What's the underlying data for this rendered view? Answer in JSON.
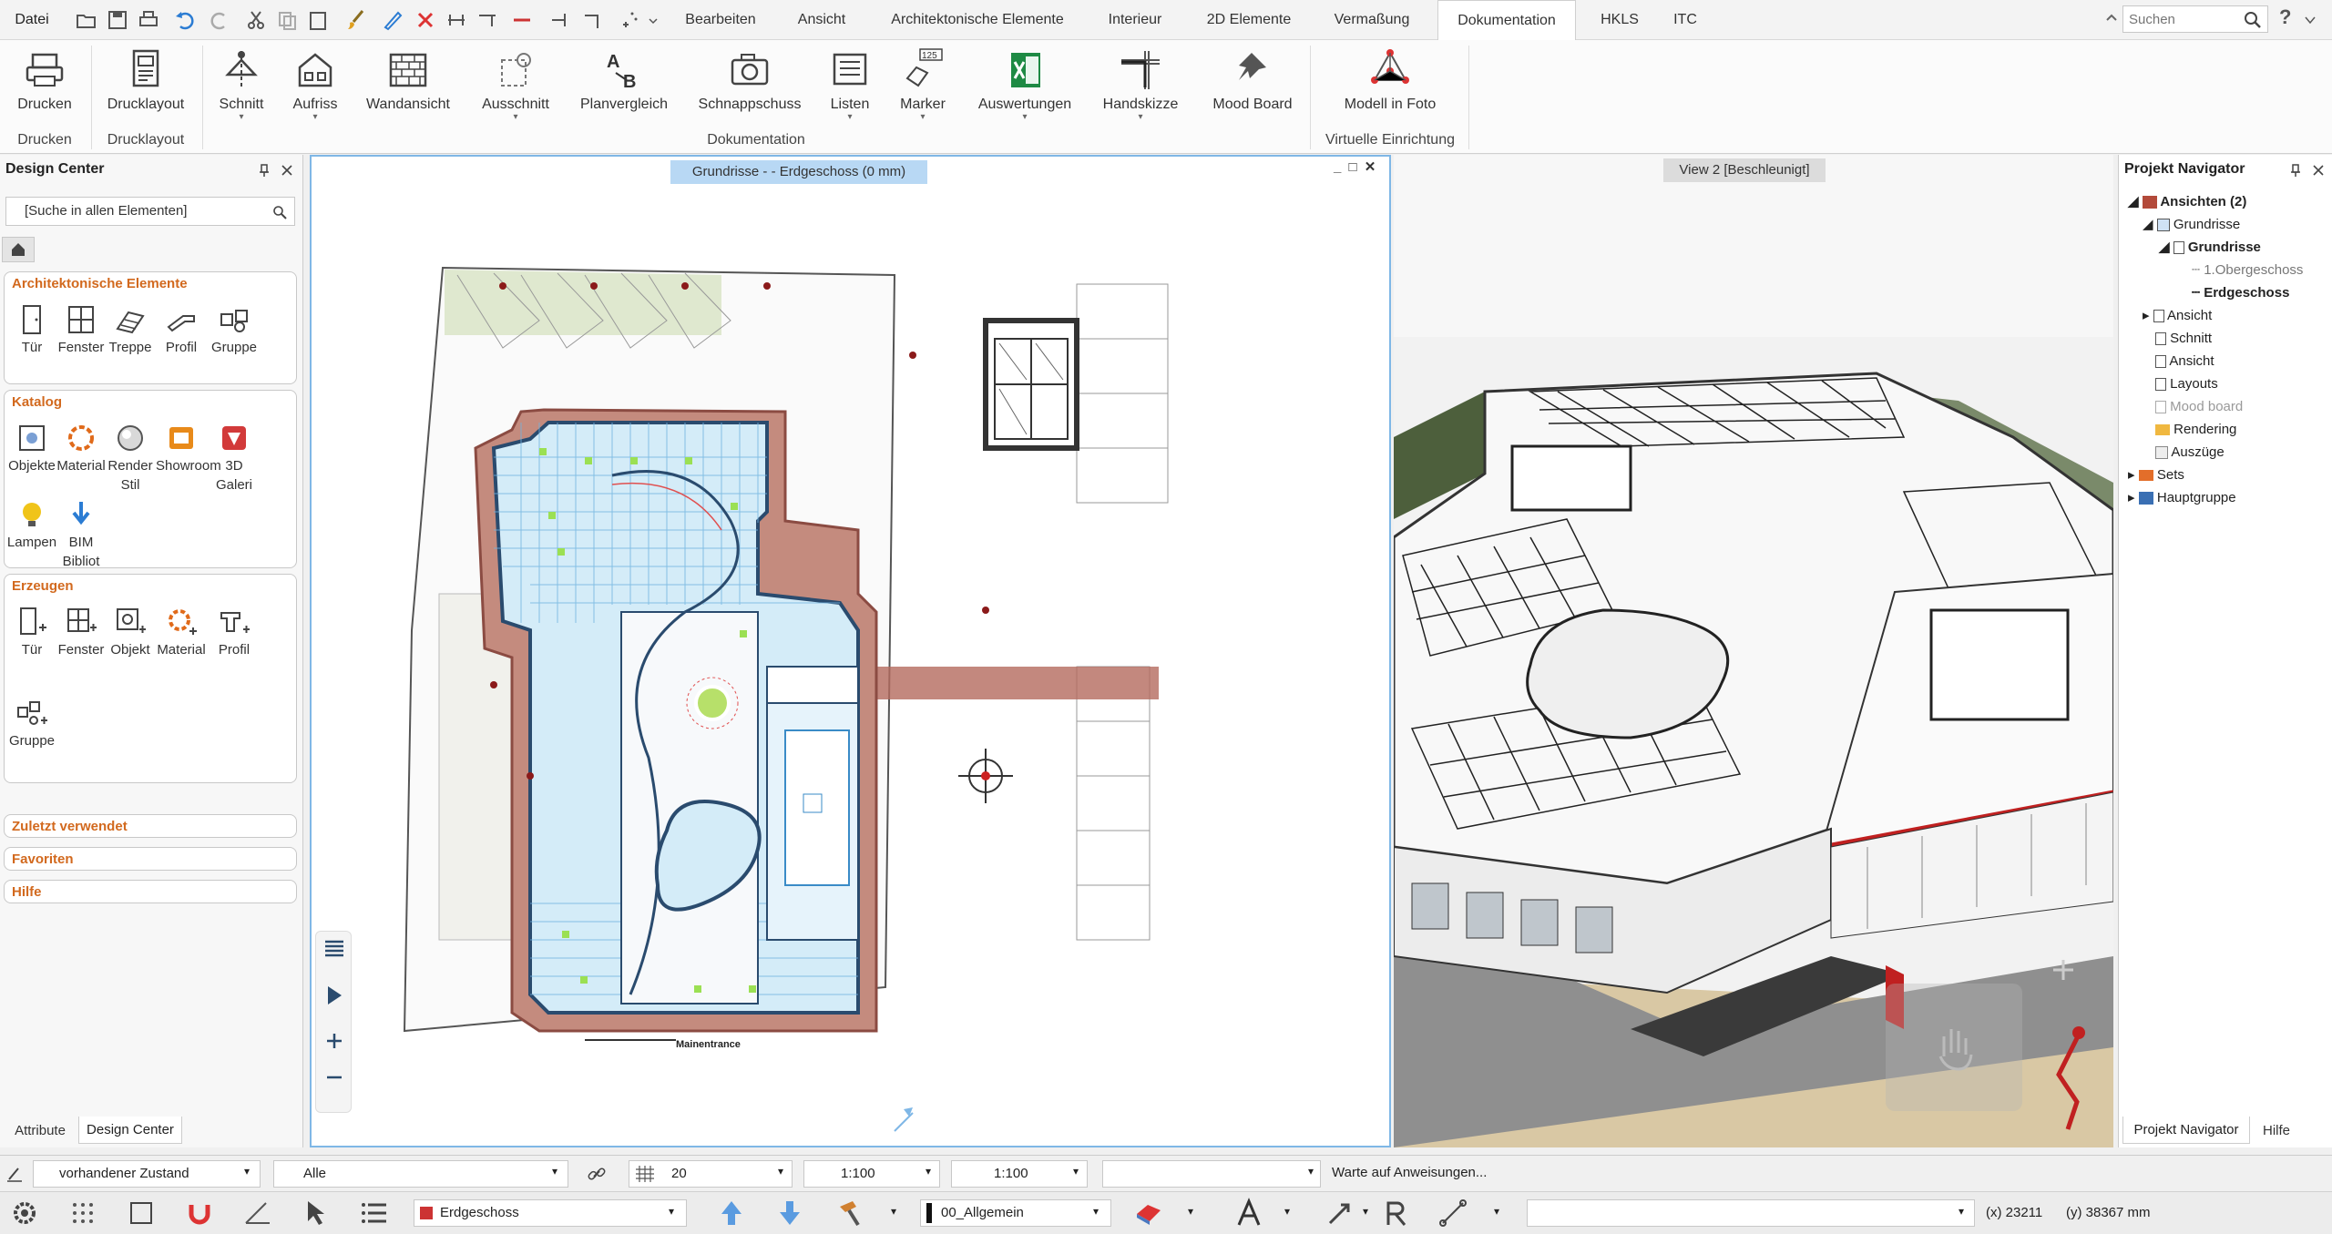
{
  "topbar": {
    "file_label": "Datei",
    "tabs": [
      "Bearbeiten",
      "Ansicht",
      "Architektonische Elemente",
      "Interieur",
      "2D Elemente",
      "Vermaßung",
      "Dokumentation",
      "HKLS",
      "ITC"
    ],
    "active_tab": "Dokumentation",
    "search_placeholder": "Suchen"
  },
  "ribbon": {
    "buttons": [
      "Drucken",
      "Drucklayout",
      "Schnitt",
      "Aufriss",
      "Wandansicht",
      "Ausschnitt",
      "Planvergleich",
      "Schnappschuss",
      "Listen",
      "Marker",
      "Auswertungen",
      "Handskizze",
      "Mood Board",
      "Modell in Foto"
    ],
    "groups": [
      "Drucken",
      "Drucklayout",
      "Dokumentation",
      "Virtuelle Einrichtung"
    ],
    "marker_badge": "125"
  },
  "design_center": {
    "title": "Design Center",
    "search_placeholder": "[Suche in allen Elementen]",
    "sections": {
      "arch": {
        "title": "Architektonische Elemente",
        "items": [
          "Tür",
          "Fenster",
          "Treppe",
          "Profil",
          "Gruppe"
        ]
      },
      "katalog": {
        "title": "Katalog",
        "items": [
          "Objekte",
          "Material",
          "Render Stil",
          "Showroom",
          "3D Galeri",
          "Lampen",
          "BIM Bibliot"
        ]
      },
      "erzeugen": {
        "title": "Erzeugen",
        "items": [
          "Tür",
          "Fenster",
          "Objekt",
          "Material",
          "Profil",
          "Gruppe"
        ]
      },
      "zuletzt": "Zuletzt verwendet",
      "favoriten": "Favoriten",
      "hilfe": "Hilfe"
    },
    "bottom_tabs": [
      "Attribute",
      "Design Center"
    ]
  },
  "viewport_plan": {
    "title": "Grundrisse -  - Erdgeschoss (0 mm)",
    "entrance_label": "Mainentrance"
  },
  "viewport_3d": {
    "title": "View 2 [Beschleunigt]"
  },
  "navigator": {
    "title": "Projekt Navigator",
    "items": [
      "Ansichten (2)",
      "Grundrisse",
      "Grundrisse",
      "1.Obergeschoss",
      "Erdgeschoss",
      "Ansicht",
      "Schnitt",
      "Ansicht",
      "Layouts",
      "Mood board",
      "Rendering",
      "Auszüge",
      "Sets",
      "Hauptgruppe"
    ],
    "bottom_tabs": [
      "Projekt Navigator",
      "Hilfe"
    ]
  },
  "statusbar": {
    "state": "vorhandener Zustand",
    "layer": "Alle",
    "hatch": "20",
    "scale1": "1:100",
    "scale2": "1:100",
    "message": "Warte auf Anweisungen...",
    "floor": "Erdgeschoss",
    "style": "00_Allgemein",
    "coord_x": "(x) 23211",
    "coord_y": "(y) 38367 mm"
  },
  "colors": {
    "accent": "#2b7cd3",
    "section_title": "#d2691e",
    "active_title": "#b8d8f4"
  }
}
